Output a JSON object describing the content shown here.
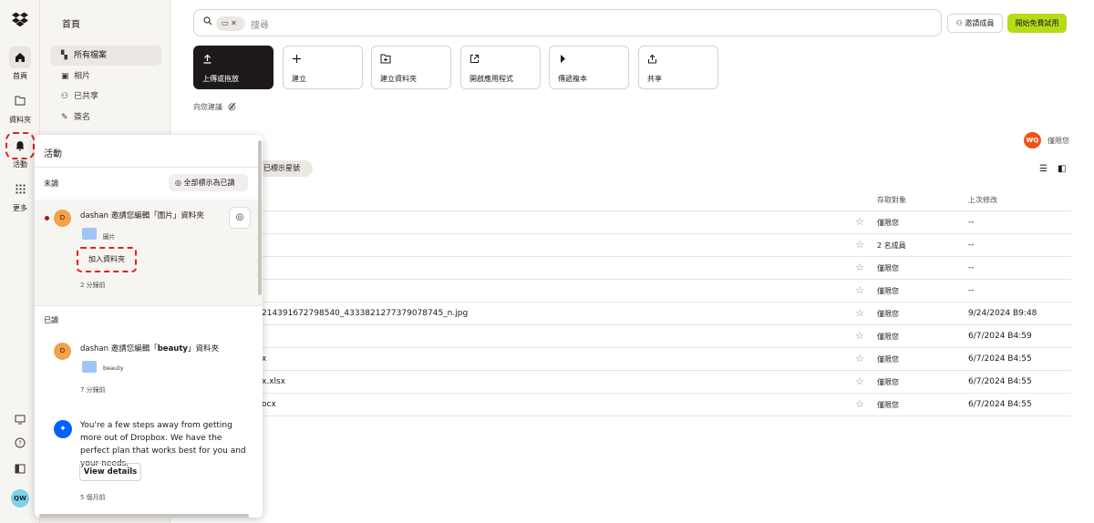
{
  "rail": {
    "items": [
      {
        "label": "首頁",
        "icon": "home-icon"
      },
      {
        "label": "資料夾",
        "icon": "folder-icon"
      },
      {
        "label": "活動",
        "icon": "bell-icon"
      },
      {
        "label": "更多",
        "icon": "grid-icon"
      }
    ],
    "avatar_initials": "QW"
  },
  "nav": {
    "title": "首頁",
    "items": [
      {
        "label": "所有檔案",
        "icon": "files-icon"
      },
      {
        "label": "相片",
        "icon": "photo-icon"
      },
      {
        "label": "已共享",
        "icon": "shared-icon"
      },
      {
        "label": "簽名",
        "icon": "signature-icon"
      }
    ]
  },
  "search": {
    "placeholder": "搜尋"
  },
  "header": {
    "invite_label": "邀請成員",
    "trial_label": "開始免費試用"
  },
  "actions": [
    {
      "label": "上傳或拖放",
      "icon": "upload-icon"
    },
    {
      "label": "建立",
      "icon": "plus-icon"
    },
    {
      "label": "建立資料夾",
      "icon": "new-folder-icon"
    },
    {
      "label": "開啟應用程式",
      "icon": "open-app-icon"
    },
    {
      "label": "傳遞複本",
      "icon": "transfer-icon"
    },
    {
      "label": "共享",
      "icon": "share-icon"
    }
  ],
  "suggestions": {
    "label": "向您建議"
  },
  "owner": {
    "initials": "WQ",
    "name": "僅限您"
  },
  "filter": {
    "starred_label": "已標示星號"
  },
  "table": {
    "headers": {
      "access": "存取對象",
      "modified": "上次修改"
    },
    "rows": [
      {
        "name": "",
        "access": "僅限您",
        "modified": "--"
      },
      {
        "name": "",
        "access": "2 名成員",
        "modified": "--"
      },
      {
        "name": "",
        "access": "僅限您",
        "modified": "--"
      },
      {
        "name": "",
        "access": "僅限您",
        "modified": "--"
      },
      {
        "name": "2143916727985​40_4333821277379078745_n.jpg",
        "access": "僅限您",
        "modified": "9/24/2024 B9:48"
      },
      {
        "name": "",
        "access": "僅限您",
        "modified": "6/7/2024 B4:59"
      },
      {
        "name": "x",
        "access": "僅限您",
        "modified": "6/7/2024 B4:55"
      },
      {
        "name": "x.xlsx",
        "access": "僅限您",
        "modified": "6/7/2024 B4:55"
      },
      {
        "name": "ocx",
        "access": "僅限您",
        "modified": "6/7/2024 B4:55"
      }
    ]
  },
  "activity": {
    "title": "活動",
    "unread_label": "未讀",
    "mark_all_label": "全部標示為已讀",
    "read_label": "已讀",
    "notifications": [
      {
        "initial": "D",
        "text": "dashan 邀請您編輯「圖片」資料夾",
        "folder": "圖片",
        "action": "加入資料夾",
        "time": "2 分鐘前"
      },
      {
        "initial": "D",
        "text_prefix": "dashan 邀請您編輯「",
        "text_bold": "beauty",
        "text_suffix": "」資料夾",
        "folder": "beauty",
        "time": "7 分鐘前"
      }
    ],
    "promo": {
      "text": "You're a few steps away from getting more out of Dropbox. We have the perfect plan that works best for you and your needs.",
      "button": "View details",
      "time": "5 個月前"
    }
  },
  "colors": {
    "accent": "#b4dc19",
    "dark": "#1e1919",
    "highlight": "#e02020",
    "owner": "#f0521c"
  }
}
